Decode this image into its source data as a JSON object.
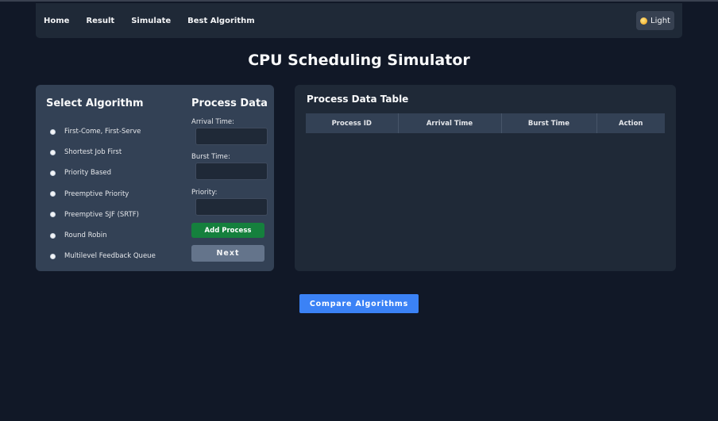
{
  "nav": {
    "links": [
      "Home",
      "Result",
      "Simulate",
      "Best Algorithm"
    ],
    "theme_toggle": {
      "icon": "sun-icon",
      "label": "Light"
    }
  },
  "page_title": "CPU Scheduling Simulator",
  "algorithms": {
    "heading": "Select Algorithm",
    "items": [
      "First-Come, First-Serve",
      "Shortest Job First",
      "Priority Based",
      "Preemptive Priority",
      "Preemptive SJF (SRTF)",
      "Round Robin",
      "Multilevel Feedback Queue"
    ]
  },
  "process_data": {
    "heading": "Process Data",
    "arrival_label": "Arrival Time:",
    "arrival_value": "",
    "burst_label": "Burst Time:",
    "burst_value": "",
    "priority_label": "Priority:",
    "priority_value": "",
    "add_button": "Add Process",
    "next_button": "Next"
  },
  "table": {
    "title": "Process Data Table",
    "columns": [
      "Process ID",
      "Arrival Time",
      "Burst Time",
      "Action"
    ],
    "rows": []
  },
  "compare_button": "Compare Algorithms",
  "colors": {
    "background": "#111827",
    "panel": "#1f2937",
    "left_panel": "#334155",
    "add_button": "#15803d",
    "next_button": "#64748b",
    "compare_button": "#3b82f6"
  }
}
